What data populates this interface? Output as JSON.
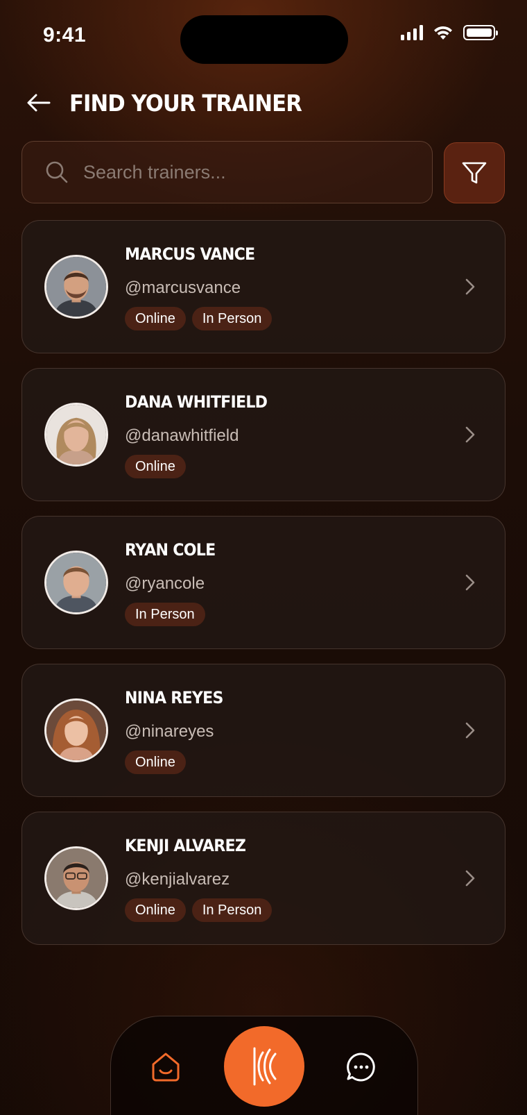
{
  "status_bar": {
    "time": "9:41"
  },
  "header": {
    "title": "FIND YOUR TRAINER",
    "back_icon": "arrow-left-icon"
  },
  "search": {
    "placeholder": "Search trainers...",
    "value": "",
    "icon": "search-icon"
  },
  "filter": {
    "icon": "filter-funnel-icon"
  },
  "trainers": [
    {
      "name": "MARCUS VANCE",
      "handle": "@marcusvance",
      "tags": [
        "Online",
        "In Person"
      ]
    },
    {
      "name": "DANA WHITFIELD",
      "handle": "@danawhitfield",
      "tags": [
        "Online"
      ]
    },
    {
      "name": "RYAN COLE",
      "handle": "@ryancole",
      "tags": [
        "In Person"
      ]
    },
    {
      "name": "NINA REYES",
      "handle": "@ninareyes",
      "tags": [
        "Online"
      ]
    },
    {
      "name": "KENJI ALVAREZ",
      "handle": "@kenjialvarez",
      "tags": [
        "Online",
        "In Person"
      ]
    }
  ],
  "bottom_nav": {
    "items": [
      "home-icon",
      "brand-logo-icon",
      "chat-bubble-icon"
    ]
  },
  "colors": {
    "accent": "#f26a2a",
    "tag_bg": "#4b2215",
    "filter_bg": "#5a2211",
    "background": "#1c0d07"
  }
}
